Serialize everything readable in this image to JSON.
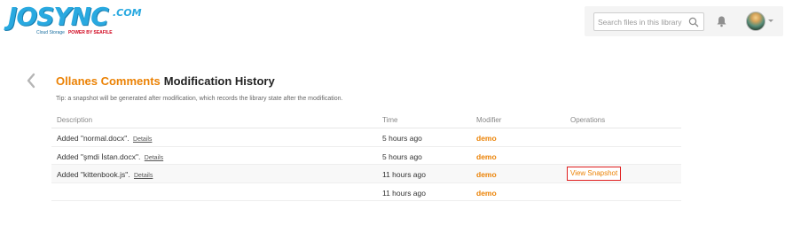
{
  "logo": {
    "brand": "JOSYNC",
    "suffix": ".COM",
    "tagline": "Cloud Storage",
    "powered_by": "POWER BY SEAFILE"
  },
  "header": {
    "search": {
      "placeholder": "Search files in this library",
      "value": ""
    }
  },
  "page": {
    "title_repo": "Ollanes Comments",
    "title_rest": "Modification History",
    "tip": "Tip: a snapshot will be generated after modification, which records the library state after the modification."
  },
  "table": {
    "headers": {
      "description": "Description",
      "time": "Time",
      "modifier": "Modifier",
      "operations": "Operations"
    },
    "rows": [
      {
        "description": "Added \"normal.docx\".",
        "details": "Details",
        "time": "5 hours ago",
        "modifier": "demo",
        "operation": ""
      },
      {
        "description": "Added \"şmdi İstan.docx\".",
        "details": "Details",
        "time": "5 hours ago",
        "modifier": "demo",
        "operation": ""
      },
      {
        "description": "Added \"kittenbook.js\".",
        "details": "Details",
        "time": "11 hours ago",
        "modifier": "demo",
        "operation": "View Snapshot"
      },
      {
        "description": "",
        "details": "",
        "time": "11 hours ago",
        "modifier": "demo",
        "operation": ""
      }
    ]
  },
  "colors": {
    "accent_orange": "#eb8205",
    "logo_blue": "#29a9e0",
    "highlight_red": "#e02020"
  }
}
